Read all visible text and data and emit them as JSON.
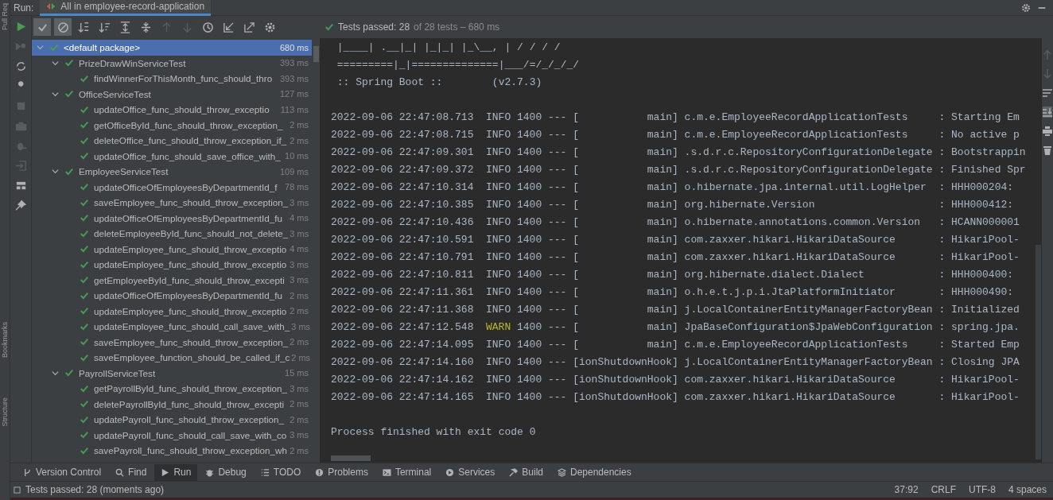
{
  "side_labels": [
    "Pull Req",
    "Bookmarks",
    "Structure"
  ],
  "run_bar": {
    "label": "Run:",
    "tab": {
      "title": "All in employee-record-application",
      "selected": true
    }
  },
  "toolbar": {
    "buttons": [
      {
        "kind": "check",
        "on": true
      },
      {
        "kind": "ignore",
        "on": true
      },
      {
        "kind": "sort-alpha",
        "on": false
      },
      {
        "kind": "sort-duration",
        "on": false
      },
      {
        "kind": "expand",
        "on": false
      },
      {
        "kind": "collapse",
        "on": false
      },
      {
        "kind": "up",
        "disabled": true
      },
      {
        "kind": "down",
        "disabled": true
      },
      {
        "kind": "history",
        "on": false
      },
      {
        "kind": "import",
        "on": false
      },
      {
        "kind": "export",
        "on": false
      },
      {
        "kind": "settings",
        "on": false
      }
    ],
    "summary": {
      "main": "Tests passed: 28",
      "rest": "of 28 tests – 680 ms"
    }
  },
  "tree": [
    {
      "name": "<default package>",
      "duration": "680 ms",
      "passed": true,
      "expanded": true,
      "selected": true,
      "children": [
        {
          "name": "PrizeDrawWinServiceTest",
          "duration": "393 ms",
          "passed": true,
          "expanded": true,
          "selected": false,
          "children": [
            {
              "name": "findWinnerForThisMonth_func_should_thro",
              "duration": "393 ms",
              "passed": true,
              "selected": false
            }
          ]
        },
        {
          "name": "OfficeServiceTest",
          "duration": "127 ms",
          "passed": true,
          "expanded": true,
          "selected": false,
          "children": [
            {
              "name": "updateOffice_func_should_throw_exceptio",
              "duration": "113 ms",
              "passed": true,
              "selected": false
            },
            {
              "name": "getOfficeById_func_should_throw_exception_",
              "duration": "2 ms",
              "passed": true,
              "selected": false
            },
            {
              "name": "deleteOffice_func_should_throw_exception_if_",
              "duration": "2 ms",
              "passed": true,
              "selected": false
            },
            {
              "name": "updateOffice_func_should_save_office_with_",
              "duration": "10 ms",
              "passed": true,
              "selected": false
            }
          ]
        },
        {
          "name": "EmployeeServiceTest",
          "duration": "109 ms",
          "passed": true,
          "expanded": true,
          "selected": false,
          "children": [
            {
              "name": "updateOfficeOfEmployeesByDepartmentId_f",
              "duration": "78 ms",
              "passed": true,
              "selected": false
            },
            {
              "name": "saveEmployee_func_should_throw_exception_",
              "duration": "3 ms",
              "passed": true,
              "selected": false
            },
            {
              "name": "updateOfficeOfEmployeesByDepartmentId_fu",
              "duration": "4 ms",
              "passed": true,
              "selected": false
            },
            {
              "name": "deleteEmployeeById_func_should_not_delete_",
              "duration": "3 ms",
              "passed": true,
              "selected": false
            },
            {
              "name": "updateEmployee_func_should_throw_exceptio",
              "duration": "4 ms",
              "passed": true,
              "selected": false
            },
            {
              "name": "updateEmployee_func_should_throw_exceptio",
              "duration": "3 ms",
              "passed": true,
              "selected": false
            },
            {
              "name": "getEmployeeById_func_should_throw_excepti",
              "duration": "3 ms",
              "passed": true,
              "selected": false
            },
            {
              "name": "updateOfficeOfEmployeesByDepartmentId_fu",
              "duration": "2 ms",
              "passed": true,
              "selected": false
            },
            {
              "name": "updateEmployee_func_should_throw_exceptio",
              "duration": "2 ms",
              "passed": true,
              "selected": false
            },
            {
              "name": "updateEmployee_func_should_call_save_with_",
              "duration": "3 ms",
              "passed": true,
              "selected": false
            },
            {
              "name": "saveEmployee_func_should_throw_exception_",
              "duration": "2 ms",
              "passed": true,
              "selected": false
            },
            {
              "name": "saveEmployee_function_should_be_called_if_c",
              "duration": "2 ms",
              "passed": true,
              "selected": false
            }
          ]
        },
        {
          "name": "PayrollServiceTest",
          "duration": "15 ms",
          "passed": true,
          "expanded": true,
          "selected": false,
          "children": [
            {
              "name": "getPayrollById_func_should_throw_exception_",
              "duration": "3 ms",
              "passed": true,
              "selected": false
            },
            {
              "name": "deletePayrollById_func_should_throw_excepti",
              "duration": "2 ms",
              "passed": true,
              "selected": false
            },
            {
              "name": "updatePayroll_func_should_throw_exception_",
              "duration": "2 ms",
              "passed": true,
              "selected": false
            },
            {
              "name": "updatePayroll_func_should_call_save_with_co",
              "duration": "3 ms",
              "passed": true,
              "selected": false
            },
            {
              "name": "savePayroll_func_should_throw_exception_wh",
              "duration": "2 ms",
              "passed": true,
              "selected": false
            }
          ]
        }
      ]
    }
  ],
  "console": {
    "banner": [
      " |____| .__|_| |_|_| |_\\__, | / / / /",
      " =========|_|==============|___/=/_/_/_/"
    ],
    "boot_label": ":: Spring Boot ::",
    "boot_version": "(v2.7.3)",
    "logs": [
      {
        "time": "2022-09-06 22:47:08.713",
        "level": "INFO",
        "pid": "1400",
        "sep": "---",
        "thread": "[           main]",
        "logger": "c.m.e.EmployeeRecordApplicationTests",
        "message": ": Starting Em"
      },
      {
        "time": "2022-09-06 22:47:08.715",
        "level": "INFO",
        "pid": "1400",
        "sep": "---",
        "thread": "[           main]",
        "logger": "c.m.e.EmployeeRecordApplicationTests",
        "message": ": No active p"
      },
      {
        "time": "2022-09-06 22:47:09.301",
        "level": "INFO",
        "pid": "1400",
        "sep": "---",
        "thread": "[           main]",
        "logger": ".s.d.r.c.RepositoryConfigurationDelegate",
        "message": ": Bootstrappin"
      },
      {
        "time": "2022-09-06 22:47:09.372",
        "level": "INFO",
        "pid": "1400",
        "sep": "---",
        "thread": "[           main]",
        "logger": ".s.d.r.c.RepositoryConfigurationDelegate",
        "message": ": Finished Spr"
      },
      {
        "time": "2022-09-06 22:47:10.314",
        "level": "INFO",
        "pid": "1400",
        "sep": "---",
        "thread": "[           main]",
        "logger": "o.hibernate.jpa.internal.util.LogHelper",
        "message": ": HHH000204:"
      },
      {
        "time": "2022-09-06 22:47:10.385",
        "level": "INFO",
        "pid": "1400",
        "sep": "---",
        "thread": "[           main]",
        "logger": "org.hibernate.Version",
        "message": ": HHH000412:"
      },
      {
        "time": "2022-09-06 22:47:10.436",
        "level": "INFO",
        "pid": "1400",
        "sep": "---",
        "thread": "[           main]",
        "logger": "o.hibernate.annotations.common.Version",
        "message": ": HCANN000001"
      },
      {
        "time": "2022-09-06 22:47:10.591",
        "level": "INFO",
        "pid": "1400",
        "sep": "---",
        "thread": "[           main]",
        "logger": "com.zaxxer.hikari.HikariDataSource",
        "message": ": HikariPool-"
      },
      {
        "time": "2022-09-06 22:47:10.791",
        "level": "INFO",
        "pid": "1400",
        "sep": "---",
        "thread": "[           main]",
        "logger": "com.zaxxer.hikari.HikariDataSource",
        "message": ": HikariPool-"
      },
      {
        "time": "2022-09-06 22:47:10.811",
        "level": "INFO",
        "pid": "1400",
        "sep": "---",
        "thread": "[           main]",
        "logger": "org.hibernate.dialect.Dialect",
        "message": ": HHH000400:"
      },
      {
        "time": "2022-09-06 22:47:11.361",
        "level": "INFO",
        "pid": "1400",
        "sep": "---",
        "thread": "[           main]",
        "logger": "o.h.e.t.j.p.i.JtaPlatformInitiator",
        "message": ": HHH000490:"
      },
      {
        "time": "2022-09-06 22:47:11.368",
        "level": "INFO",
        "pid": "1400",
        "sep": "---",
        "thread": "[           main]",
        "logger": "j.LocalContainerEntityManagerFactoryBean",
        "message": ": Initialized"
      },
      {
        "time": "2022-09-06 22:47:12.548",
        "level": "WARN",
        "pid": "1400",
        "sep": "---",
        "thread": "[           main]",
        "logger": "JpaBaseConfiguration$JpaWebConfiguration",
        "message": ": spring.jpa."
      },
      {
        "time": "2022-09-06 22:47:14.095",
        "level": "INFO",
        "pid": "1400",
        "sep": "---",
        "thread": "[           main]",
        "logger": "c.m.e.EmployeeRecordApplicationTests",
        "message": ": Started Emp"
      },
      {
        "time": "2022-09-06 22:47:14.160",
        "level": "INFO",
        "pid": "1400",
        "sep": "---",
        "thread": "[ionShutdownHook]",
        "logger": "j.LocalContainerEntityManagerFactoryBean",
        "message": ": Closing JPA"
      },
      {
        "time": "2022-09-06 22:47:14.162",
        "level": "INFO",
        "pid": "1400",
        "sep": "---",
        "thread": "[ionShutdownHook]",
        "logger": "com.zaxxer.hikari.HikariDataSource",
        "message": ": HikariPool-"
      },
      {
        "time": "2022-09-06 22:47:14.165",
        "level": "INFO",
        "pid": "1400",
        "sep": "---",
        "thread": "[ionShutdownHook]",
        "logger": "com.zaxxer.hikari.HikariDataSource",
        "message": ": HikariPool-"
      }
    ],
    "finish": "Process finished with exit code 0"
  },
  "tool_tabs": [
    {
      "label": "Version Control",
      "kind": "vcs",
      "selected": false
    },
    {
      "label": "Find",
      "kind": "find",
      "selected": false
    },
    {
      "label": "Run",
      "kind": "run",
      "selected": true
    },
    {
      "label": "Debug",
      "kind": "debug",
      "selected": false
    },
    {
      "label": "TODO",
      "kind": "todo",
      "selected": false
    },
    {
      "label": "Problems",
      "kind": "problems",
      "selected": false
    },
    {
      "label": "Terminal",
      "kind": "terminal",
      "selected": false
    },
    {
      "label": "Services",
      "kind": "services",
      "selected": false
    },
    {
      "label": "Build",
      "kind": "build",
      "selected": false
    },
    {
      "label": "Dependencies",
      "kind": "deps",
      "selected": false
    }
  ],
  "status_bar": {
    "message": "Tests passed: 28 (moments ago)",
    "position": "37:92",
    "line_ending": "CRLF",
    "encoding": "UTF-8",
    "indent": "4 spaces"
  }
}
